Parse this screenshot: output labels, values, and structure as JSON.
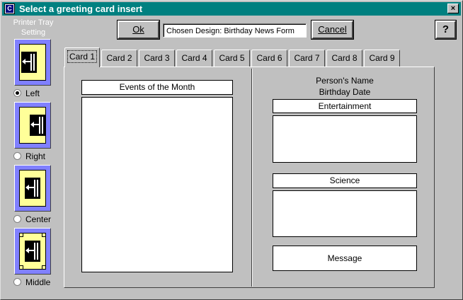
{
  "window": {
    "title": "Select a greeting card insert",
    "app_icon_letter": "C",
    "close_glyph": "×"
  },
  "toolbar": {
    "ok_label": "Ok",
    "design_field": "Chosen Design:  Birthday News Form",
    "cancel_label": "Cancel",
    "help_label": "?"
  },
  "tray": {
    "title_line1": "Printer Tray",
    "title_line2": "Setting",
    "options": [
      {
        "label": "Left",
        "selected": true
      },
      {
        "label": "Right",
        "selected": false
      },
      {
        "label": "Center",
        "selected": false
      },
      {
        "label": "Middle",
        "selected": false
      }
    ]
  },
  "tabs": [
    "Card 1",
    "Card 2",
    "Card 3",
    "Card 4",
    "Card 5",
    "Card 6",
    "Card 7",
    "Card 8",
    "Card 9"
  ],
  "active_tab": 0,
  "left_panel": {
    "events_header": "Events of the Month"
  },
  "right_panel": {
    "person_name": "Person's Name",
    "birthday_date": "Birthday Date",
    "entertainment_header": "Entertainment",
    "science_header": "Science",
    "message_label": "Message"
  },
  "colors": {
    "titlebar": "#008080",
    "face": "#c0c0c0",
    "tray_bg": "#8080ff",
    "paper": "#ffff99"
  }
}
